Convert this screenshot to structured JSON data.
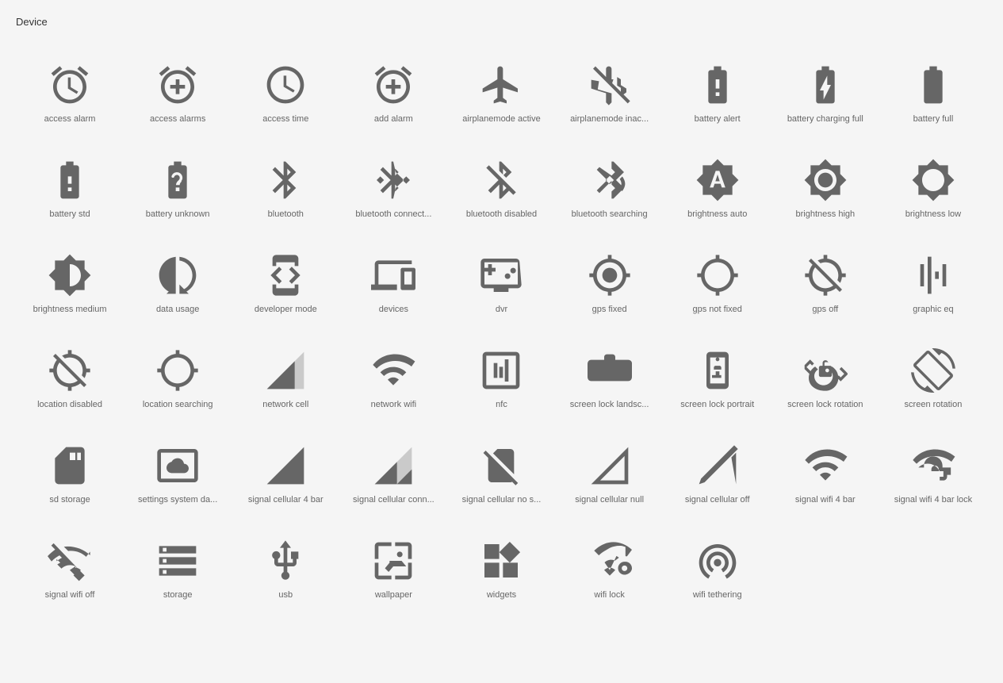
{
  "section": {
    "title": "Device"
  },
  "icons": [
    {
      "name": "access alarm",
      "id": "access-alarm"
    },
    {
      "name": "access alarms",
      "id": "access-alarms"
    },
    {
      "name": "access time",
      "id": "access-time"
    },
    {
      "name": "add alarm",
      "id": "add-alarm"
    },
    {
      "name": "airplanemode active",
      "id": "airplanemode-active"
    },
    {
      "name": "airplanemode inac...",
      "id": "airplanemode-inactive"
    },
    {
      "name": "battery alert",
      "id": "battery-alert"
    },
    {
      "name": "battery charging full",
      "id": "battery-charging-full"
    },
    {
      "name": "battery full",
      "id": "battery-full"
    },
    {
      "name": "battery std",
      "id": "battery-std"
    },
    {
      "name": "battery unknown",
      "id": "battery-unknown"
    },
    {
      "name": "bluetooth",
      "id": "bluetooth"
    },
    {
      "name": "bluetooth connect...",
      "id": "bluetooth-connected"
    },
    {
      "name": "bluetooth disabled",
      "id": "bluetooth-disabled"
    },
    {
      "name": "bluetooth searching",
      "id": "bluetooth-searching"
    },
    {
      "name": "brightness auto",
      "id": "brightness-auto"
    },
    {
      "name": "brightness high",
      "id": "brightness-high"
    },
    {
      "name": "brightness low",
      "id": "brightness-low"
    },
    {
      "name": "brightness medium",
      "id": "brightness-medium"
    },
    {
      "name": "data usage",
      "id": "data-usage"
    },
    {
      "name": "developer mode",
      "id": "developer-mode"
    },
    {
      "name": "devices",
      "id": "devices"
    },
    {
      "name": "dvr",
      "id": "dvr"
    },
    {
      "name": "gps fixed",
      "id": "gps-fixed"
    },
    {
      "name": "gps not fixed",
      "id": "gps-not-fixed"
    },
    {
      "name": "gps off",
      "id": "gps-off"
    },
    {
      "name": "graphic eq",
      "id": "graphic-eq"
    },
    {
      "name": "location disabled",
      "id": "location-disabled"
    },
    {
      "name": "location searching",
      "id": "location-searching"
    },
    {
      "name": "network cell",
      "id": "network-cell"
    },
    {
      "name": "network wifi",
      "id": "network-wifi"
    },
    {
      "name": "nfc",
      "id": "nfc"
    },
    {
      "name": "screen lock landsc...",
      "id": "screen-lock-landscape"
    },
    {
      "name": "screen lock portrait",
      "id": "screen-lock-portrait"
    },
    {
      "name": "screen lock rotation",
      "id": "screen-lock-rotation"
    },
    {
      "name": "screen rotation",
      "id": "screen-rotation"
    },
    {
      "name": "sd storage",
      "id": "sd-storage"
    },
    {
      "name": "settings system da...",
      "id": "settings-system-daydream"
    },
    {
      "name": "signal cellular 4 bar",
      "id": "signal-cellular-4-bar"
    },
    {
      "name": "signal cellular conn...",
      "id": "signal-cellular-connected"
    },
    {
      "name": "signal cellular no s...",
      "id": "signal-cellular-no-sim"
    },
    {
      "name": "signal cellular null",
      "id": "signal-cellular-null"
    },
    {
      "name": "signal cellular off",
      "id": "signal-cellular-off"
    },
    {
      "name": "signal wifi 4 bar",
      "id": "signal-wifi-4-bar"
    },
    {
      "name": "signal wifi 4 bar lock",
      "id": "signal-wifi-4-bar-lock"
    },
    {
      "name": "signal wifi off",
      "id": "signal-wifi-off"
    },
    {
      "name": "storage",
      "id": "storage"
    },
    {
      "name": "usb",
      "id": "usb"
    },
    {
      "name": "wallpaper",
      "id": "wallpaper"
    },
    {
      "name": "widgets",
      "id": "widgets"
    },
    {
      "name": "wifi lock",
      "id": "wifi-lock"
    },
    {
      "name": "wifi tethering",
      "id": "wifi-tethering"
    }
  ]
}
